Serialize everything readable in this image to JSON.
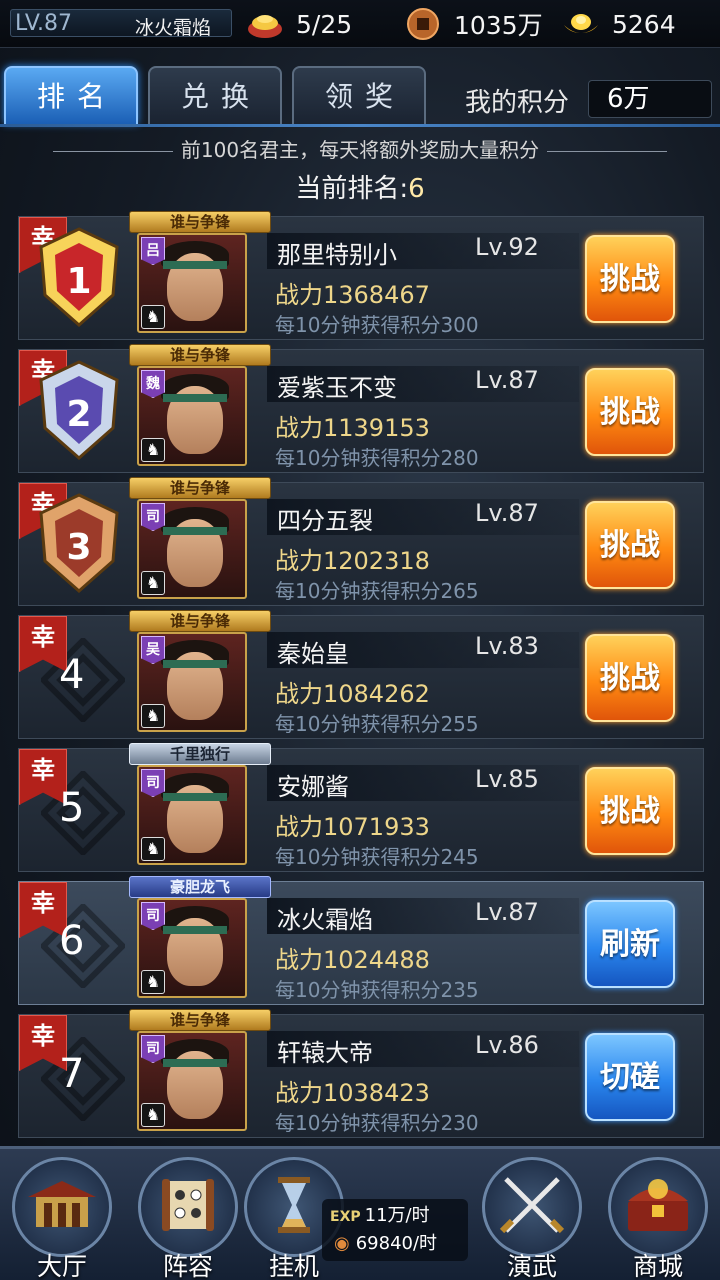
{
  "topbar": {
    "level": "LV.87",
    "player_name": "冰火霜焰",
    "stamina": "5/25",
    "copper": "1035万",
    "gold": "5264",
    "icons": [
      "treasure-bowl-icon",
      "copper-coin-icon",
      "gold-ingot-icon"
    ]
  },
  "tabs": [
    {
      "label": "排名",
      "active": true
    },
    {
      "label": "兑换",
      "active": false
    },
    {
      "label": "领奖",
      "active": false
    }
  ],
  "my_score": {
    "label": "我的积分",
    "value": "6万"
  },
  "notice": "前100名君主，每天将额外奖励大量积分",
  "current_rank": {
    "label": "当前排名:",
    "value": "6"
  },
  "rows": [
    {
      "rank": "1",
      "luck": "幸",
      "title": "谁与争锋",
      "faction": "吕",
      "name": "那里特别小",
      "level": "Lv.92",
      "power_label": "战力",
      "power": "1368467",
      "rate": "每10分钟获得积分300",
      "button": "挑战",
      "button_style": "orange"
    },
    {
      "rank": "2",
      "luck": "幸",
      "title": "谁与争锋",
      "faction": "魏",
      "name": "爱紫玉不变",
      "level": "Lv.87",
      "power_label": "战力",
      "power": "1139153",
      "rate": "每10分钟获得积分280",
      "button": "挑战",
      "button_style": "orange"
    },
    {
      "rank": "3",
      "luck": "幸",
      "title": "谁与争锋",
      "faction": "司",
      "name": "四分五裂",
      "level": "Lv.87",
      "power_label": "战力",
      "power": "1202318",
      "rate": "每10分钟获得积分265",
      "button": "挑战",
      "button_style": "orange"
    },
    {
      "rank": "4",
      "luck": "幸",
      "title": "谁与争锋",
      "faction": "吴",
      "name": "秦始皇",
      "level": "Lv.83",
      "power_label": "战力",
      "power": "1084262",
      "rate": "每10分钟获得积分255",
      "button": "挑战",
      "button_style": "orange"
    },
    {
      "rank": "5",
      "luck": "幸",
      "title": "千里独行",
      "faction": "司",
      "name": "安娜酱",
      "level": "Lv.85",
      "power_label": "战力",
      "power": "1071933",
      "rate": "每10分钟获得积分245",
      "button": "挑战",
      "button_style": "orange"
    },
    {
      "rank": "6",
      "luck": "幸",
      "title": "豪胆龙飞",
      "faction": "司",
      "name": "冰火霜焰",
      "level": "Lv.87",
      "power_label": "战力",
      "power": "1024488",
      "rate": "每10分钟获得积分235",
      "button": "刷新",
      "button_style": "blue",
      "is_me": true
    },
    {
      "rank": "7",
      "luck": "幸",
      "title": "谁与争锋",
      "faction": "司",
      "name": "轩辕大帝",
      "level": "Lv.86",
      "power_label": "战力",
      "power": "1038423",
      "rate": "每10分钟获得积分230",
      "button": "切磋",
      "button_style": "blue"
    }
  ],
  "bottom_nav": [
    {
      "label": "大厅",
      "icon": "palace-icon"
    },
    {
      "label": "阵容",
      "icon": "scroll-formation-icon"
    },
    {
      "label": "挂机",
      "icon": "hourglass-icon"
    },
    {
      "label": "演武",
      "icon": "crossed-swords-icon"
    },
    {
      "label": "商城",
      "icon": "treasure-chest-icon"
    }
  ],
  "idle": {
    "exp_tag": "EXP",
    "exp_rate": "11万/时",
    "coin_rate": "69840/时"
  }
}
